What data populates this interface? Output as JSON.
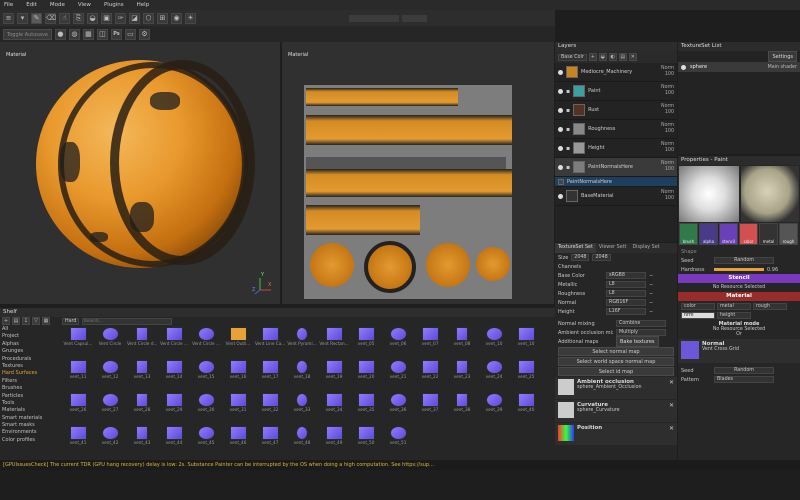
{
  "menu": [
    "File",
    "Edit",
    "Mode",
    "View",
    "Plugins",
    "Help"
  ],
  "toolbar": {
    "toggle_label": "Toggle Autosave",
    "ps_label": "Ps",
    "icons": [
      "brush-icon",
      "eraser-icon",
      "smudge-icon",
      "clone-icon",
      "fill-icon",
      "picker-icon",
      "projection-icon",
      "geometry-mask-icon",
      "sphere-icon",
      "camera-icon",
      "settings-icon"
    ]
  },
  "viewport3d": {
    "label": "Material"
  },
  "viewport2d": {
    "label": "Material"
  },
  "axes": {
    "x": "X",
    "y": "Y",
    "z": "Z"
  },
  "layers": {
    "title": "Layers",
    "channel_select": "Base Colr",
    "items": [
      {
        "name": "Mediocre_Machinery",
        "blend": "Norm",
        "opacity": "100"
      },
      {
        "name": "Paint",
        "blend": "Norm",
        "opacity": "100"
      },
      {
        "name": "Rust",
        "blend": "Norm",
        "opacity": "100"
      },
      {
        "name": "Roughness",
        "blend": "Norm",
        "opacity": "100"
      },
      {
        "name": "Height",
        "blend": "Norm",
        "opacity": "100"
      },
      {
        "name": "PaintNormalsHere",
        "blend": "Norm",
        "opacity": "100"
      },
      {
        "name": "PaintNormalsHere",
        "blend": "",
        "opacity": ""
      },
      {
        "name": "BaseMaterial",
        "blend": "Norm",
        "opacity": "100"
      }
    ]
  },
  "textureset_settings": {
    "tabs": [
      "TextureSet Set",
      "Viewer Sett",
      "Display Set"
    ],
    "size_label": "Size",
    "size_value": "2048",
    "size_value2": "2048",
    "channels_label": "Channels",
    "channels": [
      {
        "name": "Base Color",
        "format": "sRGB8"
      },
      {
        "name": "Metallic",
        "format": "L8"
      },
      {
        "name": "Roughness",
        "format": "L8"
      },
      {
        "name": "Normal",
        "format": "RGB16F"
      },
      {
        "name": "Height",
        "format": "L16F"
      }
    ],
    "normal_mixing_label": "Normal mixing",
    "normal_mixing_value": "Combine",
    "ao_mixing_label": "Ambient occlusion mixing",
    "ao_mixing_value": "Multiply",
    "additional_maps_label": "Additional maps",
    "bake_button": "Bake textures",
    "select_normal": "Select normal map",
    "select_world_normal": "Select world space normal map",
    "select_id": "Select id map",
    "maps": [
      {
        "title": "Ambient occlusion",
        "value": "sphere_Ambient_Occlusion"
      },
      {
        "title": "Curvature",
        "value": "sphere_Curvature"
      },
      {
        "title": "Position",
        "value": ""
      }
    ]
  },
  "textureset_list": {
    "title": "TextureSet List",
    "settings_button": "Settings",
    "item": "sphere",
    "shader": "Main shader"
  },
  "properties": {
    "title": "Properties - Paint",
    "thumbs": [
      "brush",
      "alpha",
      "stencil",
      "color",
      "metal",
      "rough"
    ],
    "brush_type_label": "Shape",
    "seed_label": "Seed",
    "seed_value": "Random",
    "hardness_label": "Hardness",
    "hardness_value": "0.96",
    "stencil_header": "Stencil",
    "stencil_value": "No Resource Selected",
    "material_header": "Material",
    "mat_buttons": [
      "color",
      "metal",
      "rough",
      "nrm",
      "height"
    ],
    "material_mode_label": "Material mode",
    "material_mode_value": "No Resource Selected",
    "or_label": "Or",
    "normal_title": "Normal",
    "normal_value": "Vent Cross Grid",
    "seed2_label": "Seed",
    "seed2_value": "Random",
    "pattern_label": "Pattern",
    "pattern_value": "Blades"
  },
  "shelf": {
    "title": "Shelf",
    "filter": "Hard",
    "search_placeholder": "Search...",
    "categories": [
      "All",
      "Project",
      "Alphas",
      "Grunges",
      "Procedurals",
      "Textures",
      "Hard Surfaces",
      "Filters",
      "Brushes",
      "Particles",
      "Tools",
      "Materials",
      "Smart materials",
      "Smart masks",
      "Environments",
      "Color profiles"
    ],
    "active_category": "Hard Surfaces",
    "items": [
      "Vent Capsul...",
      "Vent Circle",
      "Vent Circle d...",
      "Vent Circle ...",
      "Vent Circle ...",
      "Vent Outli...",
      "Vent Line Ca...",
      "Vent Pyrami...",
      "Vent Rectan...",
      "vent_05",
      "vent_06",
      "vent_07",
      "vent_08",
      "vent_10",
      "vent_10",
      "vent_11",
      "vent_12",
      "vent_13",
      "vent_14",
      "vent_15",
      "vent_16",
      "vent_17",
      "vent_18",
      "vent_19",
      "vent_20",
      "vent_21",
      "vent_22",
      "vent_23",
      "vent_24",
      "vent_25",
      "vent_26",
      "vent_27",
      "vent_28",
      "vent_29",
      "vent_30",
      "vent_31",
      "vent_32",
      "vent_33",
      "vent_34",
      "vent_35",
      "vent_36",
      "vent_37",
      "vent_38",
      "vent_39",
      "vent_40",
      "vent_41",
      "vent_42",
      "vent_43",
      "vent_44",
      "vent_45",
      "vent_46",
      "vent_47",
      "vent_48",
      "vent_49",
      "vent_50",
      "vent_51"
    ]
  },
  "status": "[GPUIssuesCheck] The current TDR (GPU hang recovery) delay is low: 2s. Substance Painter can be interrupted by the OS when doing a high computation. See https://sup..."
}
